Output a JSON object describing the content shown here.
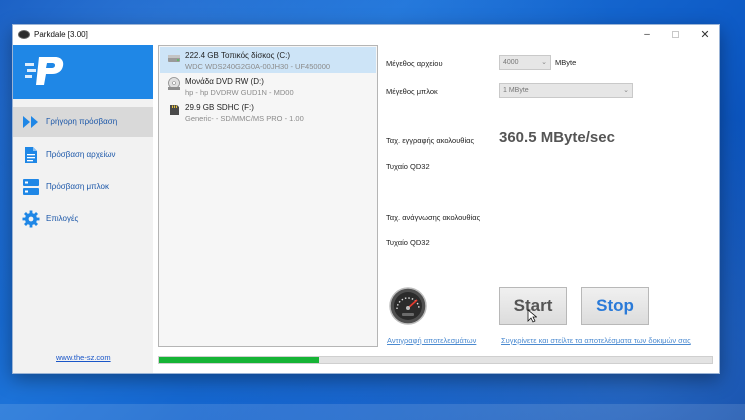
{
  "window": {
    "title": "Parkdale [3.00]"
  },
  "sidebar": {
    "items": [
      {
        "label": "Γρήγορη πρόσβαση",
        "icon": "fast-forward-icon",
        "active": true
      },
      {
        "label": "Πρόσβαση αρχείων",
        "icon": "document-icon",
        "active": false
      },
      {
        "label": "Πρόσβαση μπλοκ",
        "icon": "blocks-icon",
        "active": false
      },
      {
        "label": "Επιλογές",
        "icon": "gear-icon",
        "active": false
      }
    ],
    "link": "www.the-sz.com"
  },
  "drives": [
    {
      "name": "222.4 GB Τοπικός δίσκος (C:)",
      "detail": "WDC WDS240G2G0A-00JH30 - UF450000",
      "icon": "hard-drive-icon",
      "selected": true
    },
    {
      "name": "Μονάδα DVD RW (D:)",
      "detail": "hp - hp        DVDRW GUD1N - MD00",
      "icon": "dvd-drive-icon",
      "selected": false
    },
    {
      "name": "29.9 GB SDHC (F:)",
      "detail": "Generic- - SD/MMC/MS PRO - 1.00",
      "icon": "sd-card-icon",
      "selected": false
    }
  ],
  "settings": {
    "file_size_label": "Μέγεθος αρχείου",
    "file_size_value": "4000",
    "file_size_unit": "MByte",
    "block_size_label": "Μέγεθος μπλοκ",
    "block_size_value": "1 MByte"
  },
  "results": {
    "seq_write_label": "Ταχ. εγγραφής ακολουθίας",
    "seq_write_value": "360.5 MByte/sec",
    "random_qd32_write_label": "Τυχαίο QD32",
    "seq_read_label": "Ταχ. ανάγνωσης ακολουθίας",
    "random_qd32_read_label": "Τυχαίο QD32"
  },
  "actions": {
    "start_label": "Start",
    "stop_label": "Stop",
    "copy_results_label": "Αντιγραφή αποτελεσμάτων",
    "submit_results_label": "Συγκρίνετε και στείλτε τα αποτελέσματα των δοκιμών σας"
  },
  "progress": {
    "fraction": 0.29
  },
  "colors": {
    "accent": "#1f87e6",
    "progress": "#16b436",
    "link": "#4b8ad0",
    "desktop": "#0e5bc6"
  }
}
